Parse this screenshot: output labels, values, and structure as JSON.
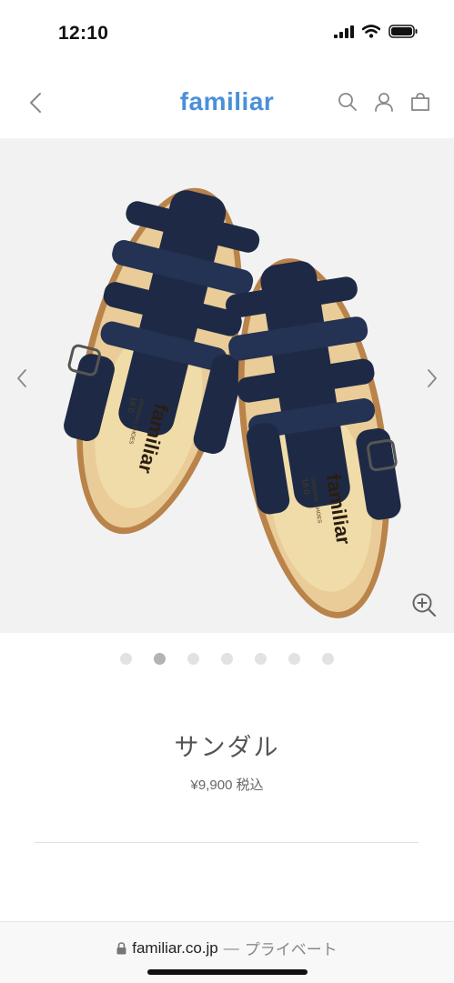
{
  "status_bar": {
    "time": "12:10"
  },
  "header": {
    "logo": "familiar"
  },
  "product": {
    "insole_brand": "familiar",
    "insole_sub": "ORIGINAL SHOES",
    "insole_size": "18.0",
    "name": "サンダル",
    "price": "¥9,900",
    "tax_label": "税込"
  },
  "gallery": {
    "total_images": 7,
    "active_index": 1
  },
  "browser": {
    "domain": "familiar.co.jp",
    "separator": "—",
    "mode_label": "プライベート"
  },
  "colors": {
    "logo_blue": "#4a90d9",
    "sandal_navy": "#1e2a45",
    "background": "#f2f2f2"
  },
  "icons": [
    "signal-icon",
    "wifi-icon",
    "battery-icon",
    "back-chevron-icon",
    "search-icon",
    "account-icon",
    "cart-icon",
    "prev-chevron-icon",
    "next-chevron-icon",
    "zoom-in-icon",
    "lock-icon"
  ]
}
